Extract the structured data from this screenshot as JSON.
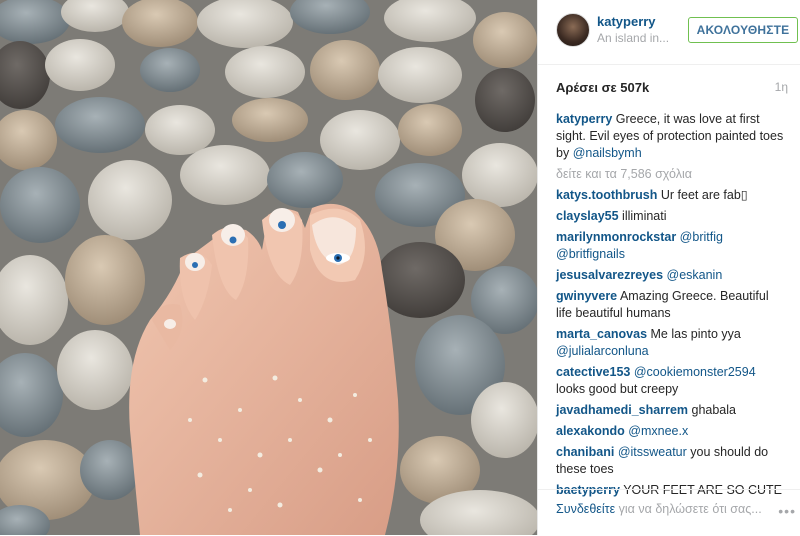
{
  "post": {
    "username": "katyperry",
    "location": "An island in...",
    "follow_label": "ΑΚΟΛΟΥΘΗΣΤΕ",
    "likes": "Αρέσει σε 507k",
    "age": "1η"
  },
  "caption": {
    "username": "katyperry",
    "text": "Greece, it was love at first sight. Evil eyes of protection painted toes by",
    "mention": "@nailsbymh"
  },
  "view_more": "δείτε και τα 7,586 σχόλια",
  "comments": [
    {
      "user": "katys.toothbrush",
      "text": "Ur feet are fab",
      "mention": ""
    },
    {
      "user": "clayslay55",
      "text": "illiminati",
      "mention": ""
    },
    {
      "user": "marilynmonrockstar",
      "text": "",
      "mention": "@britfig @britfignails"
    },
    {
      "user": "jesusalvarezreyes",
      "text": "",
      "mention": "@eskanin"
    },
    {
      "user": "gwinyvere",
      "text": "Amazing Greece. Beautiful life beautiful humans",
      "mention": ""
    },
    {
      "user": "marta_canovas",
      "text": "Me las pinto yya",
      "mention": "@julialarconluna"
    },
    {
      "user": "catective153",
      "text": "looks good but creepy",
      "mention": "@cookiemonster2594",
      "mention_first": true
    },
    {
      "user": "javadhamedi_sharrem",
      "text": "ghabala",
      "mention": ""
    },
    {
      "user": "alexakondo",
      "text": "",
      "mention": "@mxnee.x"
    },
    {
      "user": "chanibani",
      "text": "you should do these toes",
      "mention": "@itssweatur",
      "mention_first": true
    },
    {
      "user": "baetyperry",
      "text": "YOUR FEET ARE SO CUTE",
      "mention": ""
    }
  ],
  "footer": {
    "login_link": "Συνδεθείτε",
    "login_text": "για να δηλώσετε ότι σας...",
    "more_icon": "ellipsis-icon"
  },
  "colors": {
    "link_blue": "#125688",
    "follow_border": "#70c050",
    "muted": "#a5a7aa"
  }
}
